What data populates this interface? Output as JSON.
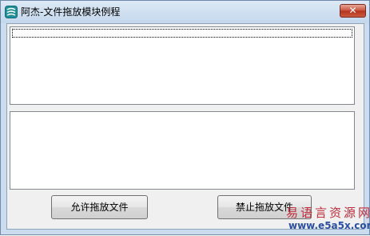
{
  "window": {
    "title": "阿杰-文件拖放模块例程",
    "close_glyph": "✕"
  },
  "buttons": {
    "allow_drag_drop": "允许拖放文件",
    "forbid_drag_drop": "禁止拖放文件"
  },
  "watermark": {
    "site_name": "易语言资源网",
    "url": "www.e5a5x.com"
  },
  "colors": {
    "title_bar": "#c4d7ec",
    "close_button": "#c8503a",
    "watermark_red": "#c12b3a",
    "watermark_blue": "#2a4fa3"
  },
  "icons": {
    "app_icon": "app-logo-icon",
    "close_icon": "close-icon"
  }
}
